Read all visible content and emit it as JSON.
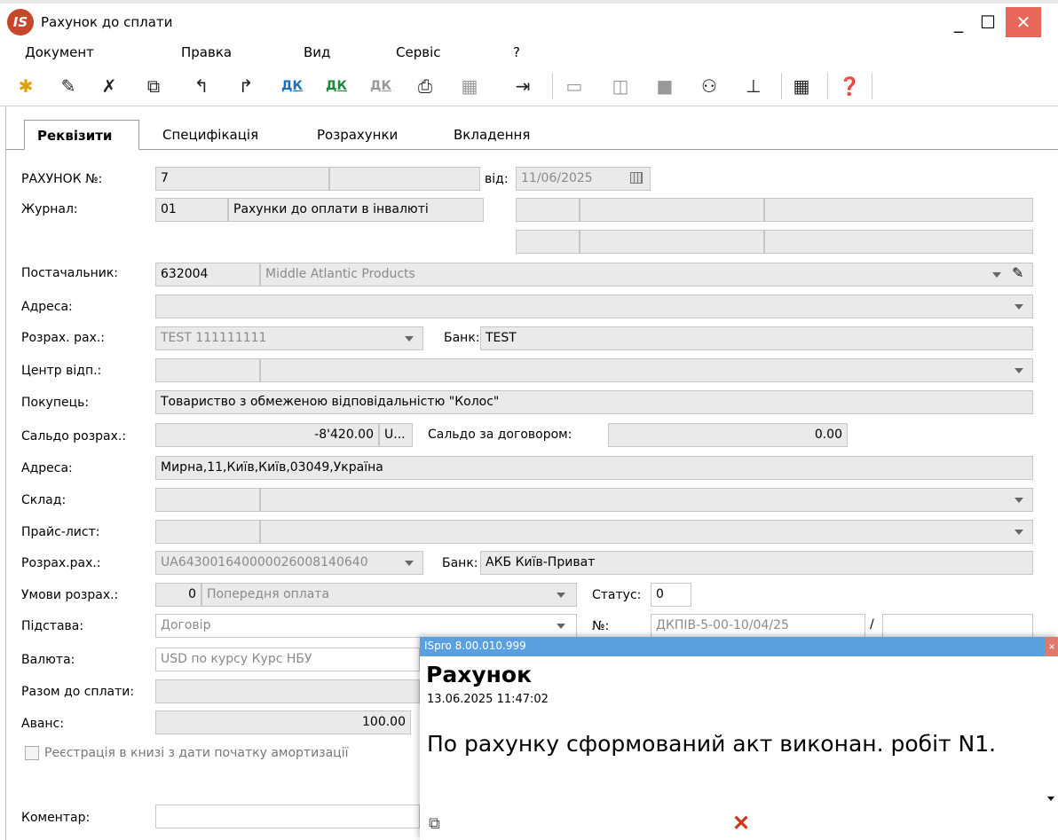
{
  "window": {
    "logo": "IS",
    "title": "Рахунок до сплати",
    "minimize": "_",
    "maximize": "☐",
    "close": "✕"
  },
  "menu": [
    "Документ",
    "Правка",
    "Вид",
    "Сервіс",
    "?"
  ],
  "toolbar": {
    "dk1": "ДК",
    "dk2": "ДК",
    "dk3": "ДК"
  },
  "tabs": [
    "Реквізити",
    "Специфікація",
    "Розрахунки",
    "Вкладення"
  ],
  "form": {
    "invoice_no_label": "РАХУНОК №:",
    "invoice_no": "7",
    "from_label": "від:",
    "from_date": "11/06/2025",
    "journal_label": "Журнал:",
    "journal_code": "01",
    "journal_name": "Рахунки до оплати в інвалюті",
    "supplier_label": "Постачальник:",
    "supplier_code": "632004",
    "supplier_name": "Middle Atlantic Products",
    "address1_label": "Адреса:",
    "account1_label": "Розрах. рах.:",
    "account1_value": "TEST 111111111",
    "bank1_label": "Банк:",
    "bank1_value": "TEST",
    "center_label": "Центр відп.:",
    "buyer_label": "Покупець:",
    "buyer_value": "Товариство з обмеженою відповідальністю \"Колос\"",
    "balance_label": "Сальдо розрах.:",
    "balance_value": "-8'420.00",
    "balance_currency": "U...",
    "contract_balance_label": "Сальдо за договором:",
    "contract_balance_value": "0.00",
    "address2_label": "Адреса:",
    "address2_value": "Мирна,11,Київ,Київ,03049,Україна",
    "warehouse_label": "Склад:",
    "pricelist_label": "Прайс-лист:",
    "account2_label": "Розрах.рах.:",
    "account2_value": "UA643001640000026008140640",
    "bank2_label": "Банк:",
    "bank2_value": "АКБ Київ-Приват",
    "terms_label": "Умови розрах.:",
    "terms_code": "0",
    "terms_value": "Попередня оплата",
    "status_label": "Статус:",
    "status_value": "0",
    "basis_label": "Підстава:",
    "basis_value": "Договір",
    "no_label": "№:",
    "no_value": "ДКПІВ-5-00-10/04/25",
    "slash": "/",
    "currency_label": "Валюта:",
    "currency_value": "USD по курсу Курс НБУ",
    "total_label": "Разом до сплати:",
    "advance_label": "Аванс:",
    "advance_value": "100.00",
    "register_checkbox_label": "Реєстрація в книзі з дати початку амортизації",
    "comment_label": "Коментар:"
  },
  "popup": {
    "title": "ISpro 8.00.010.999",
    "close": "×",
    "heading": "Рахунок",
    "datetime": "13.06.2025 11:47:02",
    "message": "По рахунку сформований акт виконан. робіт N1."
  }
}
